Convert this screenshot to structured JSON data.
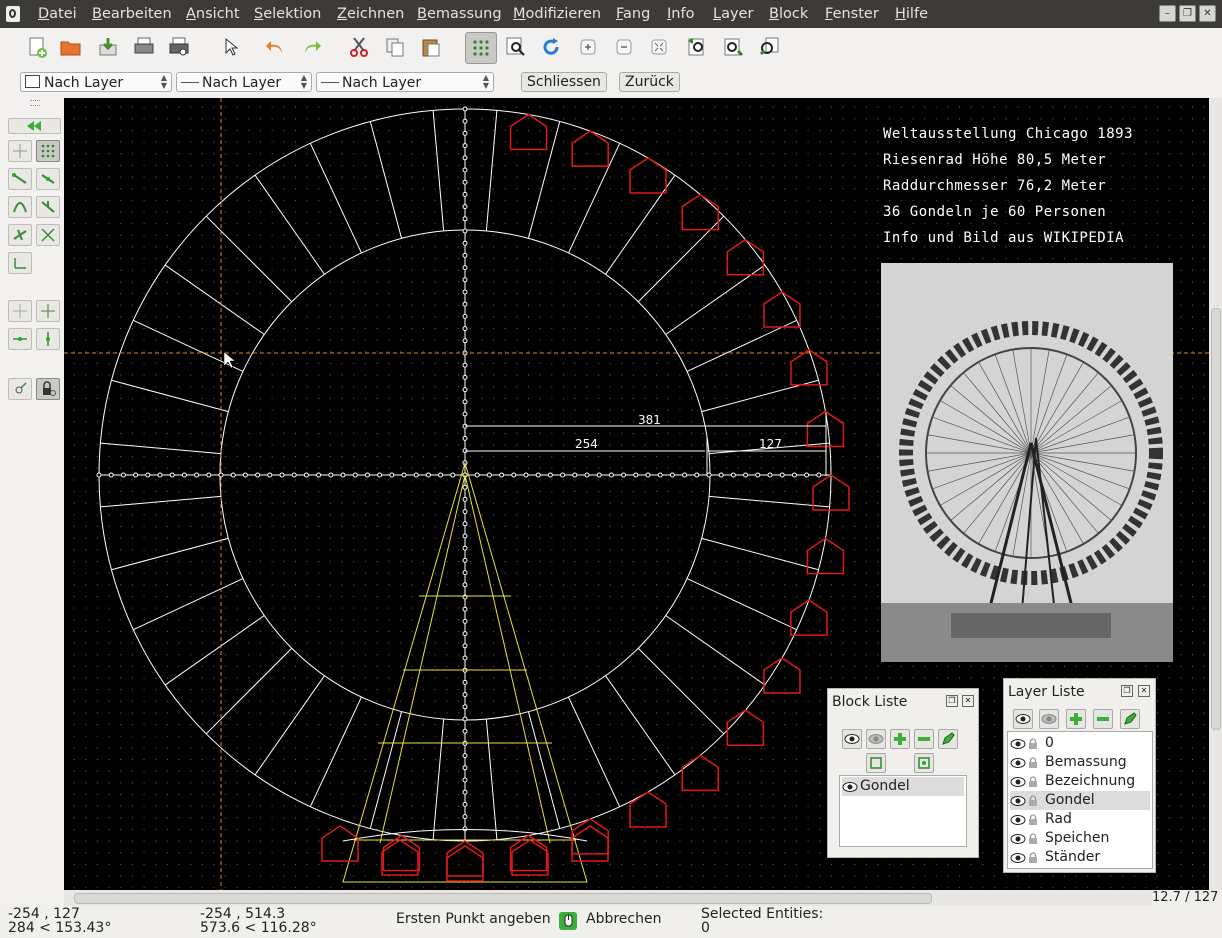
{
  "menubar": {
    "items": [
      "Datei",
      "Bearbeiten",
      "Ansicht",
      "Selektion",
      "Zeichnen",
      "Bemassung",
      "Modifizieren",
      "Fang",
      "Info",
      "Layer",
      "Block",
      "Fenster",
      "Hilfe"
    ],
    "underline": [
      "D",
      "B",
      "A",
      "S",
      "Z",
      "B",
      "M",
      "F",
      "I",
      "L",
      "B",
      "F",
      "H"
    ]
  },
  "penbar": {
    "color_combo": "Nach Layer",
    "width_combo": "Nach Layer",
    "type_combo": "Nach Layer",
    "close_button": "Schliessen",
    "back_button": "Zurück"
  },
  "canvas": {
    "text_lines": [
      "Weltausstellung Chicago 1893",
      "Riesenrad Höhe 80,5 Meter",
      "Raddurchmesser 76,2 Meter",
      "36 Gondeln je 60 Personen",
      "Info und Bild aus WIKIPEDIA"
    ],
    "dim_381": "381",
    "dim_254": "254",
    "dim_127": "127",
    "grid_spacing": "12.7 / 127"
  },
  "block_list": {
    "title": "Block Liste",
    "items": [
      "Gondel"
    ]
  },
  "layer_list": {
    "title": "Layer Liste",
    "items": [
      "0",
      "Bemassung",
      "Bezeichnung",
      "Gondel",
      "Rad",
      "Speichen",
      "Ständer"
    ],
    "selected": "Gondel"
  },
  "status": {
    "abs_coord": "-254 , 127",
    "abs_polar": "284 < 153.43°",
    "rel_coord": "-254 , 514.3",
    "rel_polar": "573.6 < 116.28°",
    "prompt": "Ersten Punkt angeben",
    "cancel": "Abbrechen",
    "selected_label": "Selected Entities:",
    "selected_count": "0"
  },
  "colors": {
    "menubar_bg": "#3c3b37",
    "canvas_bg": "#000000",
    "gondola": "#e01a1a",
    "stand": "#e8e33a",
    "wheel": "#ffffff",
    "crosshair": "#d58a2a"
  }
}
